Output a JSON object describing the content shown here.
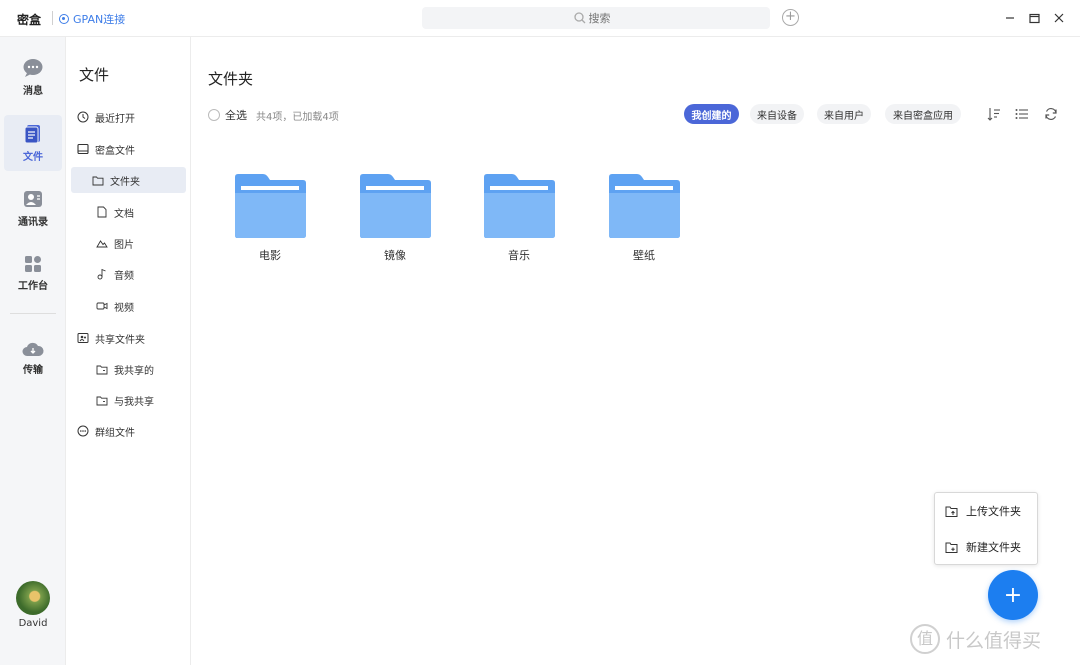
{
  "topbar": {
    "app_title": "密盒",
    "gpan_label": "GPAN连接",
    "search_placeholder": "搜索"
  },
  "rail": {
    "items": [
      {
        "label": "消息",
        "icon": "chat-icon"
      },
      {
        "label": "文件",
        "icon": "file-icon"
      },
      {
        "label": "通讯录",
        "icon": "contacts-icon"
      },
      {
        "label": "工作台",
        "icon": "grid-icon"
      },
      {
        "label": "传输",
        "icon": "cloud-icon"
      }
    ],
    "user_name": "David"
  },
  "sidebar": {
    "title": "文件",
    "items": [
      {
        "label": "最近打开",
        "icon": "clock-icon"
      },
      {
        "label": "密盒文件",
        "icon": "box-icon"
      },
      {
        "label": "文件夹",
        "icon": "folder-icon"
      },
      {
        "label": "文档",
        "icon": "document-icon"
      },
      {
        "label": "图片",
        "icon": "image-icon"
      },
      {
        "label": "音频",
        "icon": "music-icon"
      },
      {
        "label": "视频",
        "icon": "video-icon"
      },
      {
        "label": "共享文件夹",
        "icon": "shared-folder-icon"
      },
      {
        "label": "我共享的",
        "icon": "share-out-icon"
      },
      {
        "label": "与我共享",
        "icon": "share-in-icon"
      },
      {
        "label": "群组文件",
        "icon": "group-icon"
      }
    ]
  },
  "main": {
    "title": "文件夹",
    "select_all_label": "全选",
    "count_text": "共4项，已加载4项",
    "filters": [
      "我创建的",
      "来自设备",
      "来自用户",
      "来自密盒应用"
    ],
    "active_filter": "我创建的",
    "folders": [
      {
        "name": "电影"
      },
      {
        "name": "镜像"
      },
      {
        "name": "音乐"
      },
      {
        "name": "壁纸"
      }
    ]
  },
  "popup": {
    "upload_folder": "上传文件夹",
    "new_folder": "新建文件夹"
  },
  "fab": {
    "label": "+"
  },
  "watermark": {
    "text": "什么值得买",
    "glyph": "值"
  },
  "colors": {
    "accent": "#4b67d8",
    "fab": "#1c7ef0",
    "folder": "#6aaaf5",
    "gpan": "#3f7ee8"
  }
}
